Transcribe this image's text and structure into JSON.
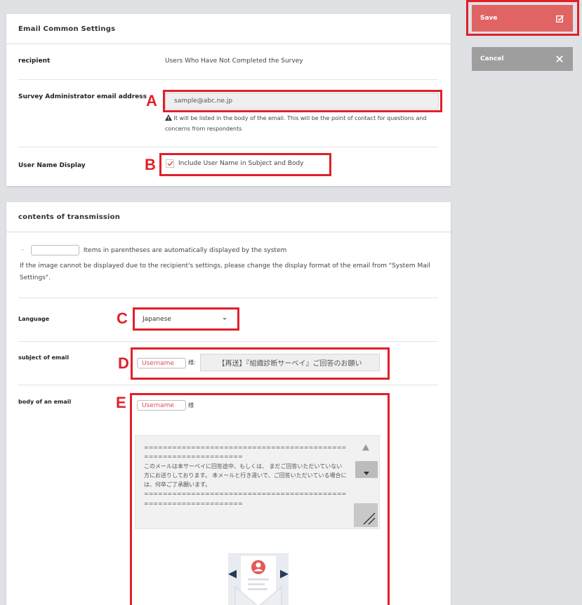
{
  "email_common": {
    "title": "Email Common Settings",
    "recipient_label": "recipient",
    "recipient_value": "Users Who Have Not Completed the Survey",
    "admin_email_label": "Survey Administrator email address",
    "admin_email_value": "sample@abc.ne.jp",
    "admin_email_note": "It will be listed in the body of the email. This will be the point of contact for questions and concerns from respondents",
    "user_name_label": "User Name Display",
    "user_name_checkbox_label": "Include User Name in Subject and Body"
  },
  "contents": {
    "title": "contents of transmission",
    "bullet": "·",
    "legend_text": "Items in parentheses are automatically displayed by the system",
    "image_note": "If the image cannot be displayed due to the recipient's settings, please change the display format of the email from \"System Mail Settings\".",
    "language_label": "Language",
    "language_value": "Japanese",
    "subject_label": "subject of email",
    "subject_tag": "Username",
    "subject_honorific": "様:",
    "subject_value": "【再送】『組織診断サーベイ』ご回答のお願い",
    "body_label": "body of an email",
    "body_tag": "Username",
    "body_honorific": "様",
    "body_text": "================================================================\nこのメールは本サーベイに回答途中、もしくは、 まだご回答いただいていない方にお送りしております。 本メールと行き違いで、ご回答いただいている場合には、何卒ご了承願います。\n================================================================"
  },
  "actions": {
    "save_label": "Save",
    "cancel_label": "Cancel"
  },
  "markers": {
    "a": "A",
    "b": "B",
    "c": "C",
    "d": "D",
    "e": "E"
  },
  "colors": {
    "save": "#e06464",
    "cancel": "#9e9e9e",
    "highlight": "#e0202a",
    "tag_text": "#e14a52"
  }
}
